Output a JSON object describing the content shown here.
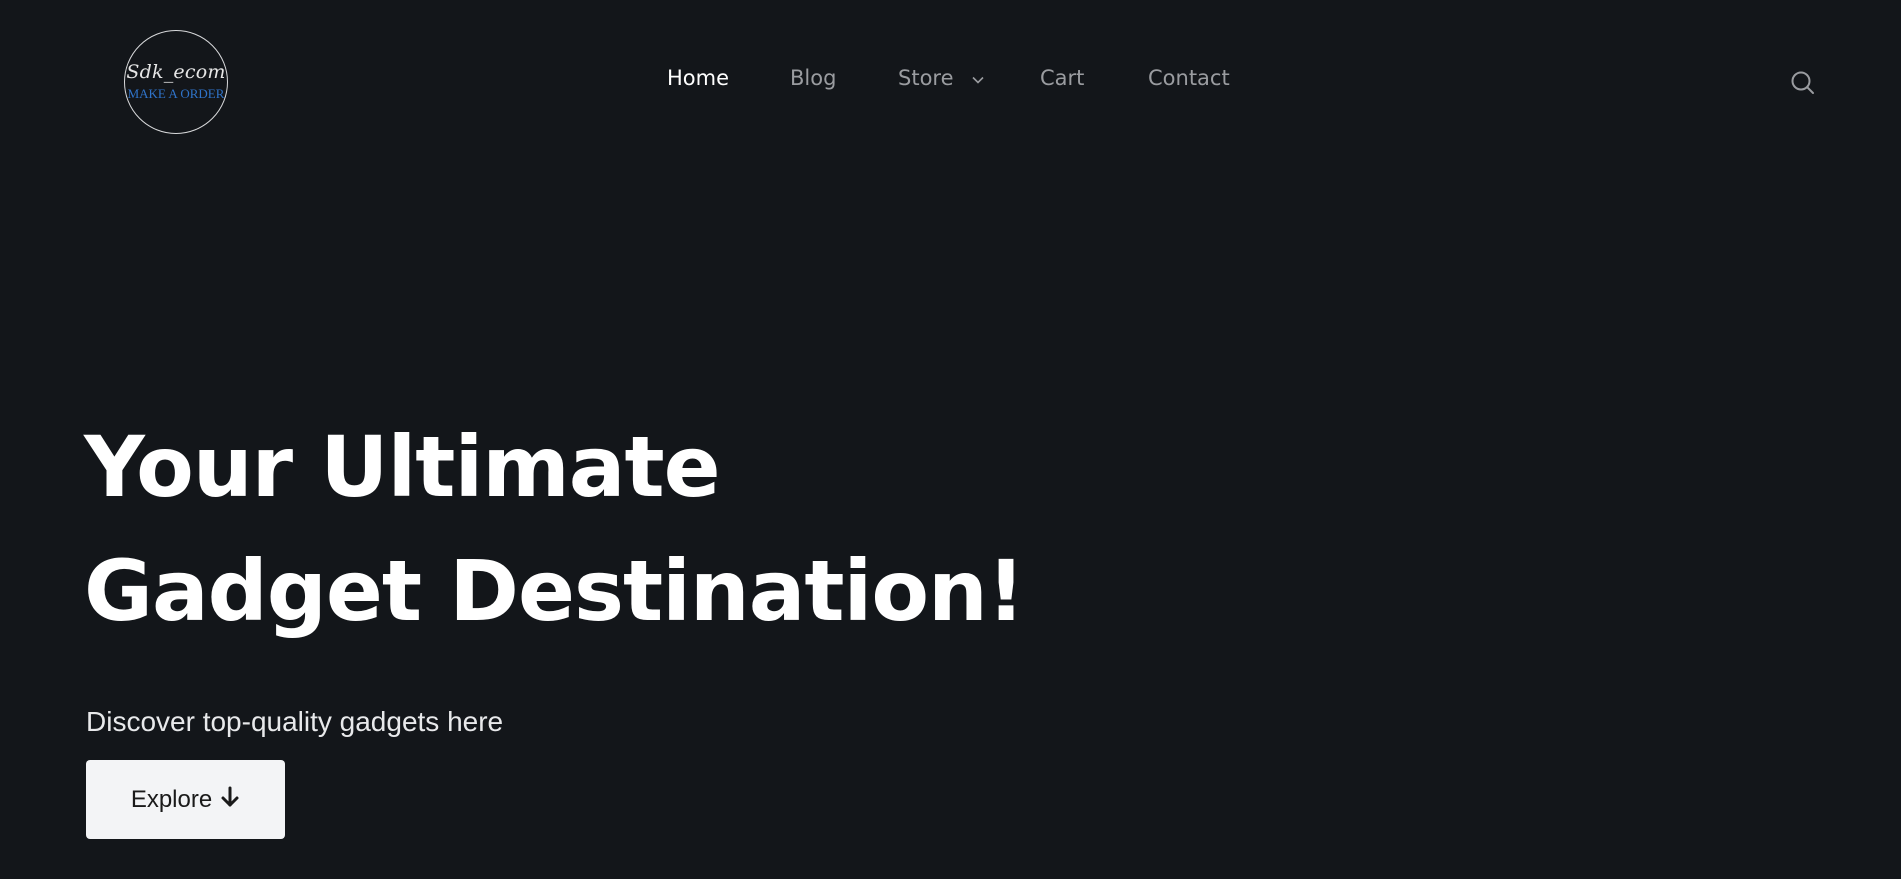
{
  "logo": {
    "script_text": "Sdk_ecom",
    "subtitle": "MAKE A ORDER"
  },
  "nav": {
    "items": [
      {
        "label": "Home",
        "active": true
      },
      {
        "label": "Blog",
        "active": false
      },
      {
        "label": "Store",
        "active": false,
        "has_dropdown": true,
        "icon": "chevron-down-icon"
      },
      {
        "label": "Cart",
        "active": false
      },
      {
        "label": "Contact",
        "active": false
      }
    ],
    "search_icon": "search-icon"
  },
  "hero": {
    "title_line1": "Your Ultimate",
    "title_line2": "Gadget Destination!",
    "subtitle": "Discover top-quality gadgets here",
    "button_label": "Explore",
    "button_icon": "arrow-down-icon"
  },
  "colors": {
    "background": "#13161a",
    "nav_active": "#ffffff",
    "nav_inactive": "#9a9ca0",
    "logo_subtitle": "#2f73c9",
    "button_bg": "#f3f4f6"
  }
}
